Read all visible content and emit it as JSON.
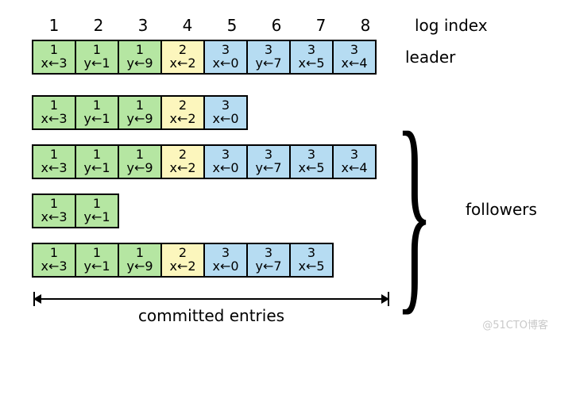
{
  "header": {
    "indices": [
      "1",
      "2",
      "3",
      "4",
      "5",
      "6",
      "7",
      "8"
    ],
    "label": "log index"
  },
  "rows": [
    {
      "role": "leader",
      "cells": [
        {
          "term": "1",
          "cmd": "x←3",
          "c": "c1"
        },
        {
          "term": "1",
          "cmd": "y←1",
          "c": "c1"
        },
        {
          "term": "1",
          "cmd": "y←9",
          "c": "c1"
        },
        {
          "term": "2",
          "cmd": "x←2",
          "c": "c2"
        },
        {
          "term": "3",
          "cmd": "x←0",
          "c": "c3"
        },
        {
          "term": "3",
          "cmd": "y←7",
          "c": "c3"
        },
        {
          "term": "3",
          "cmd": "x←5",
          "c": "c3"
        },
        {
          "term": "3",
          "cmd": "x←4",
          "c": "c3"
        }
      ]
    },
    {
      "role": "follower",
      "cells": [
        {
          "term": "1",
          "cmd": "x←3",
          "c": "c1"
        },
        {
          "term": "1",
          "cmd": "y←1",
          "c": "c1"
        },
        {
          "term": "1",
          "cmd": "y←9",
          "c": "c1"
        },
        {
          "term": "2",
          "cmd": "x←2",
          "c": "c2"
        },
        {
          "term": "3",
          "cmd": "x←0",
          "c": "c3"
        }
      ]
    },
    {
      "role": "follower",
      "cells": [
        {
          "term": "1",
          "cmd": "x←3",
          "c": "c1"
        },
        {
          "term": "1",
          "cmd": "y←1",
          "c": "c1"
        },
        {
          "term": "1",
          "cmd": "y←9",
          "c": "c1"
        },
        {
          "term": "2",
          "cmd": "x←2",
          "c": "c2"
        },
        {
          "term": "3",
          "cmd": "x←0",
          "c": "c3"
        },
        {
          "term": "3",
          "cmd": "y←7",
          "c": "c3"
        },
        {
          "term": "3",
          "cmd": "x←5",
          "c": "c3"
        },
        {
          "term": "3",
          "cmd": "x←4",
          "c": "c3"
        }
      ]
    },
    {
      "role": "follower",
      "cells": [
        {
          "term": "1",
          "cmd": "x←3",
          "c": "c1"
        },
        {
          "term": "1",
          "cmd": "y←1",
          "c": "c1"
        }
      ]
    },
    {
      "role": "follower",
      "cells": [
        {
          "term": "1",
          "cmd": "x←3",
          "c": "c1"
        },
        {
          "term": "1",
          "cmd": "y←1",
          "c": "c1"
        },
        {
          "term": "1",
          "cmd": "y←9",
          "c": "c1"
        },
        {
          "term": "2",
          "cmd": "x←2",
          "c": "c2"
        },
        {
          "term": "3",
          "cmd": "x←0",
          "c": "c3"
        },
        {
          "term": "3",
          "cmd": "y←7",
          "c": "c3"
        },
        {
          "term": "3",
          "cmd": "x←5",
          "c": "c3"
        }
      ]
    }
  ],
  "labels": {
    "leader": "leader",
    "followers": "followers",
    "committed": "committed entries"
  },
  "watermark": "@51CTO博客",
  "chart_data": {
    "type": "table",
    "title": "Raft replicated log state",
    "columns_label": "log index",
    "columns": [
      1,
      2,
      3,
      4,
      5,
      6,
      7,
      8
    ],
    "committed_upto_index": 8,
    "term_colors": {
      "1": "#b5e6a2",
      "2": "#fcf6bd",
      "3": "#b6dcf2"
    },
    "series": [
      {
        "name": "leader",
        "entries": [
          {
            "index": 1,
            "term": 1,
            "cmd": "x←3"
          },
          {
            "index": 2,
            "term": 1,
            "cmd": "y←1"
          },
          {
            "index": 3,
            "term": 1,
            "cmd": "y←9"
          },
          {
            "index": 4,
            "term": 2,
            "cmd": "x←2"
          },
          {
            "index": 5,
            "term": 3,
            "cmd": "x←0"
          },
          {
            "index": 6,
            "term": 3,
            "cmd": "y←7"
          },
          {
            "index": 7,
            "term": 3,
            "cmd": "x←5"
          },
          {
            "index": 8,
            "term": 3,
            "cmd": "x←4"
          }
        ]
      },
      {
        "name": "follower-1",
        "entries": [
          {
            "index": 1,
            "term": 1,
            "cmd": "x←3"
          },
          {
            "index": 2,
            "term": 1,
            "cmd": "y←1"
          },
          {
            "index": 3,
            "term": 1,
            "cmd": "y←9"
          },
          {
            "index": 4,
            "term": 2,
            "cmd": "x←2"
          },
          {
            "index": 5,
            "term": 3,
            "cmd": "x←0"
          }
        ]
      },
      {
        "name": "follower-2",
        "entries": [
          {
            "index": 1,
            "term": 1,
            "cmd": "x←3"
          },
          {
            "index": 2,
            "term": 1,
            "cmd": "y←1"
          },
          {
            "index": 3,
            "term": 1,
            "cmd": "y←9"
          },
          {
            "index": 4,
            "term": 2,
            "cmd": "x←2"
          },
          {
            "index": 5,
            "term": 3,
            "cmd": "x←0"
          },
          {
            "index": 6,
            "term": 3,
            "cmd": "y←7"
          },
          {
            "index": 7,
            "term": 3,
            "cmd": "x←5"
          },
          {
            "index": 8,
            "term": 3,
            "cmd": "x←4"
          }
        ]
      },
      {
        "name": "follower-3",
        "entries": [
          {
            "index": 1,
            "term": 1,
            "cmd": "x←3"
          },
          {
            "index": 2,
            "term": 1,
            "cmd": "y←1"
          }
        ]
      },
      {
        "name": "follower-4",
        "entries": [
          {
            "index": 1,
            "term": 1,
            "cmd": "x←3"
          },
          {
            "index": 2,
            "term": 1,
            "cmd": "y←1"
          },
          {
            "index": 3,
            "term": 1,
            "cmd": "y←9"
          },
          {
            "index": 4,
            "term": 2,
            "cmd": "x←2"
          },
          {
            "index": 5,
            "term": 3,
            "cmd": "x←0"
          },
          {
            "index": 6,
            "term": 3,
            "cmd": "y←7"
          },
          {
            "index": 7,
            "term": 3,
            "cmd": "x←5"
          }
        ]
      }
    ]
  }
}
